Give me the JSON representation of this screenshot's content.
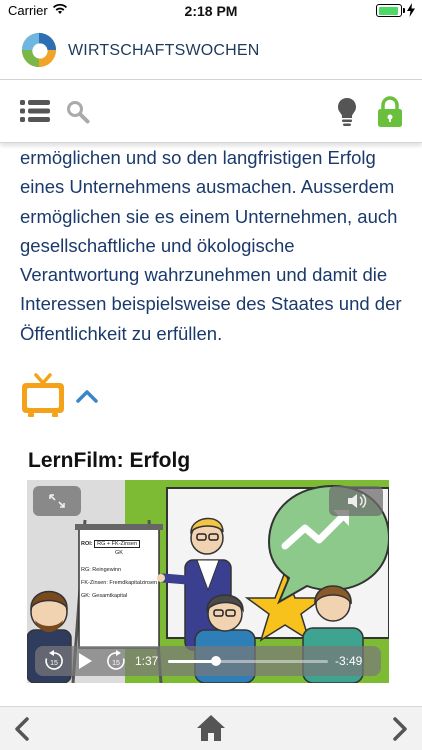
{
  "status_bar": {
    "carrier": "Carrier",
    "time": "2:18 PM",
    "battery_percent": 95
  },
  "header": {
    "brand": "WIRTSCHAFTSWOCHEN"
  },
  "toolbar": {
    "icons": [
      "list-icon",
      "search-icon",
      "lightbulb-icon",
      "lock-icon"
    ],
    "lock_color": "#6abf3c"
  },
  "article": {
    "lines": [
      "ermöglichen und so den langfristigen Erfolg",
      "eines Unternehmens ausmachen. Ausserdem",
      "ermöglichen sie es einem Unternehmen, auch",
      "gesellschaftliche und ökologische",
      "Verantwortung wahrzunehmen und damit die",
      "Interessen beispielsweise des Staates und der",
      "Öffentlichkeit zu erfüllen."
    ],
    "text_color": "#1b3a6b",
    "media_icon": "tv-icon",
    "media_icon_color": "#f5a21b"
  },
  "video": {
    "title": "LernFilm: Erfolg",
    "elapsed": "1:37",
    "remaining": "-3:49",
    "progress": 0.3,
    "flipchart": {
      "formula": "RG + FK-Zinsen",
      "formula_denominator": "GK",
      "roi_label": "ROI:",
      "legend": [
        "RG: Reingewinn",
        "FK-Zinsen: Fremdkapitalzinsen",
        "GK: Gesamtkapital"
      ]
    }
  },
  "bottom_nav": {
    "icons": [
      "chevron-left-icon",
      "home-icon",
      "chevron-right-icon"
    ]
  }
}
